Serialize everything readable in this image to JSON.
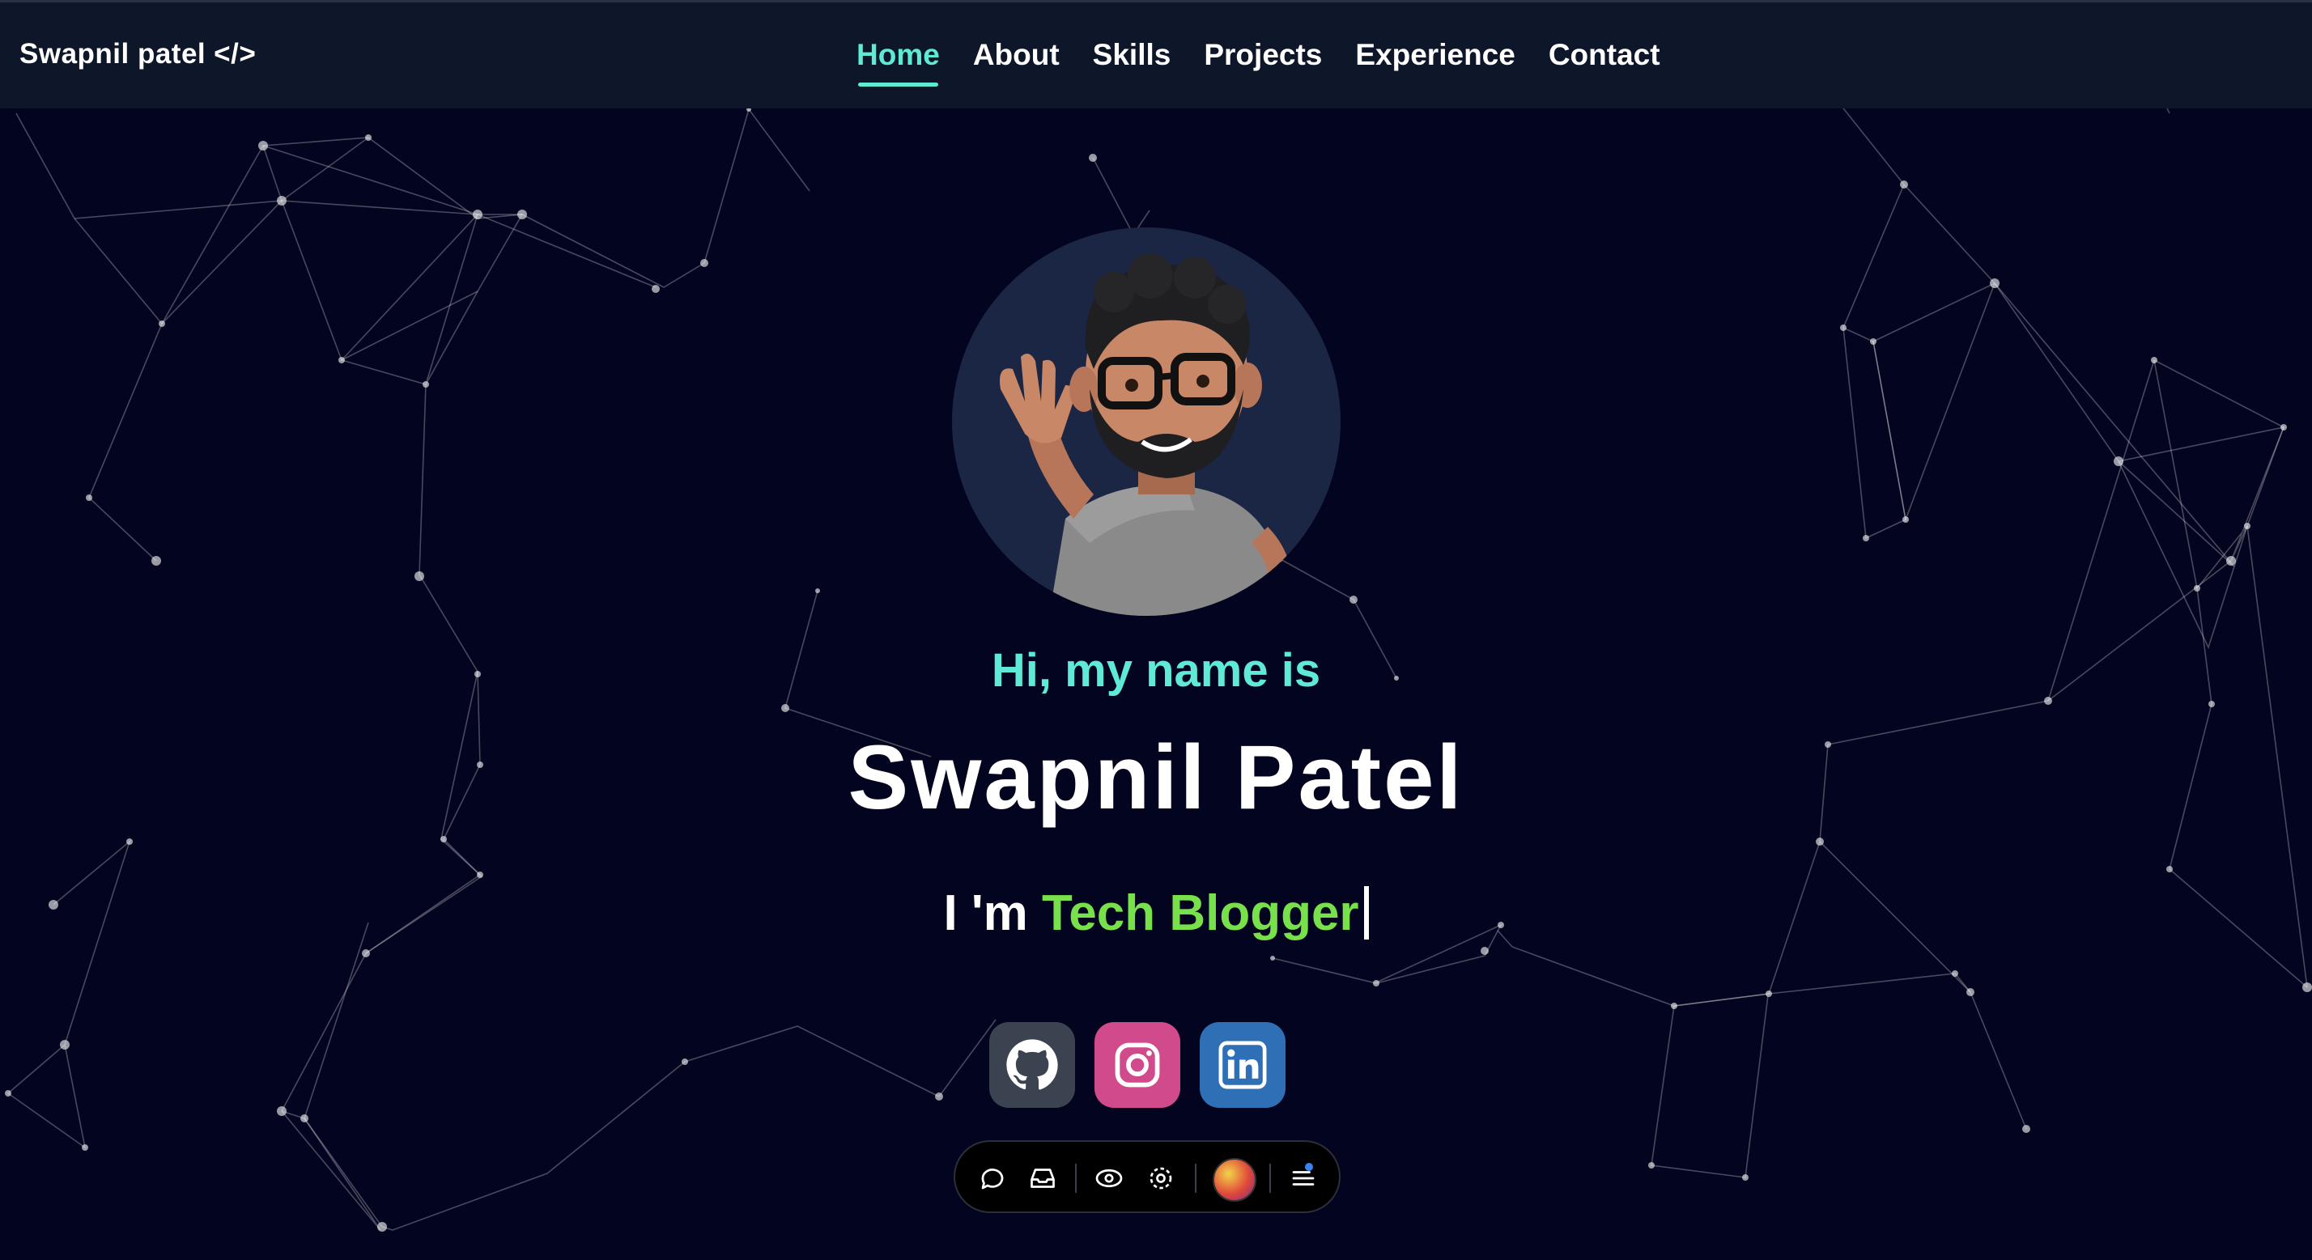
{
  "brand": {
    "name": "Swapnil patel",
    "code": "</>"
  },
  "nav": {
    "items": [
      {
        "label": "Home",
        "active": true
      },
      {
        "label": "About"
      },
      {
        "label": "Skills"
      },
      {
        "label": "Projects"
      },
      {
        "label": "Experience"
      },
      {
        "label": "Contact"
      }
    ]
  },
  "hero": {
    "avatar_icon": "memoji-avatar-waving",
    "greeting": "Hi, my name is",
    "name": "Swapnil Patel",
    "role_prefix": "I 'm",
    "role_highlight": "Tech Blogger"
  },
  "socials": [
    {
      "icon": "github-icon",
      "color": "#3b4250"
    },
    {
      "icon": "instagram-icon",
      "color": "#d14a8c"
    },
    {
      "icon": "linkedin-icon",
      "color": "#2f6fb5"
    }
  ],
  "toolbar": {
    "icons": [
      "comment-icon",
      "inbox-icon",
      "eye-icon",
      "settings-icon",
      "profile-avatar",
      "menu-icon"
    ]
  },
  "colors": {
    "background": "#03041f",
    "navbar": "#0e1629",
    "accent": "#5eead4",
    "highlight": "#77e04a"
  }
}
